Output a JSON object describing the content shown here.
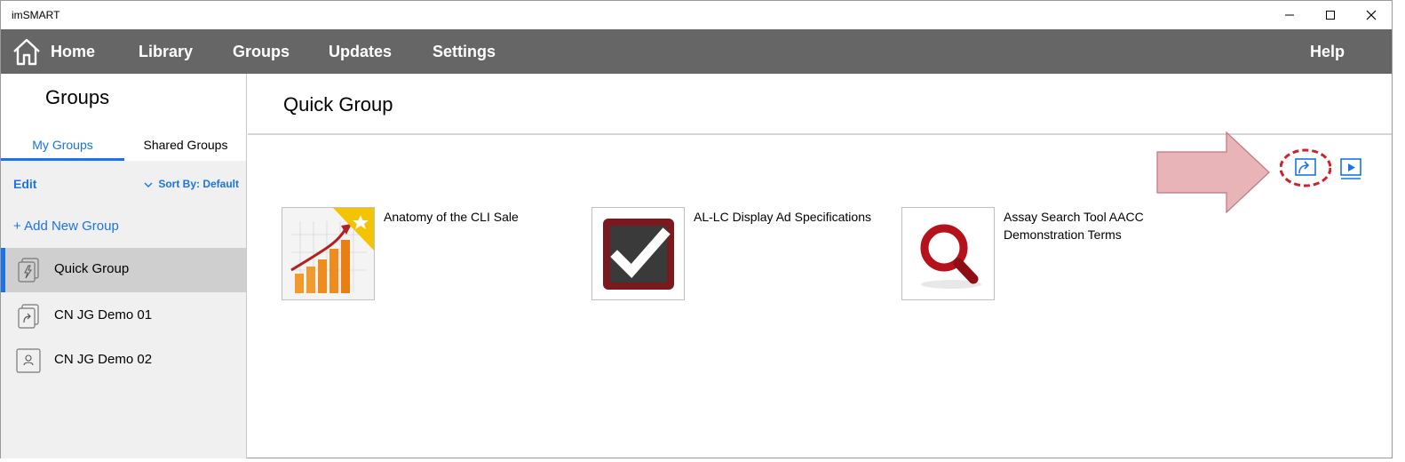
{
  "window": {
    "title": "imSMART"
  },
  "nav": {
    "items": [
      "Home",
      "Library",
      "Groups",
      "Updates",
      "Settings"
    ],
    "help": "Help"
  },
  "sidebar": {
    "title": "Groups",
    "tabs": [
      "My Groups",
      "Shared Groups"
    ],
    "edit": "Edit",
    "sort_label": "Sort By:",
    "sort_value": "Default",
    "add_group": "+ Add New Group",
    "groups": [
      {
        "label": "Quick Group",
        "icon": "quick-group-icon",
        "selected": true
      },
      {
        "label": "CN JG Demo 01",
        "icon": "shared-doc-icon",
        "selected": false
      },
      {
        "label": "CN JG Demo 02",
        "icon": "person-doc-icon",
        "selected": false
      }
    ]
  },
  "main": {
    "title": "Quick Group",
    "items": [
      {
        "label": "Anatomy of the CLI Sale",
        "thumbnail": "growth-chart-thumbnail",
        "favorite": true
      },
      {
        "label": "AL-LC Display Ad Specifications",
        "thumbnail": "checkmark-thumbnail",
        "favorite": false
      },
      {
        "label": "Assay Search Tool AACC Demonstration Terms",
        "thumbnail": "magnifier-thumbnail",
        "favorite": false
      }
    ]
  },
  "colors": {
    "accent": "#1a73e8",
    "nav_bg": "#666666",
    "sidebar_bg": "#f0f0f0",
    "highlight_red": "#d0202a",
    "arrow_fill": "#e8b4b8"
  }
}
